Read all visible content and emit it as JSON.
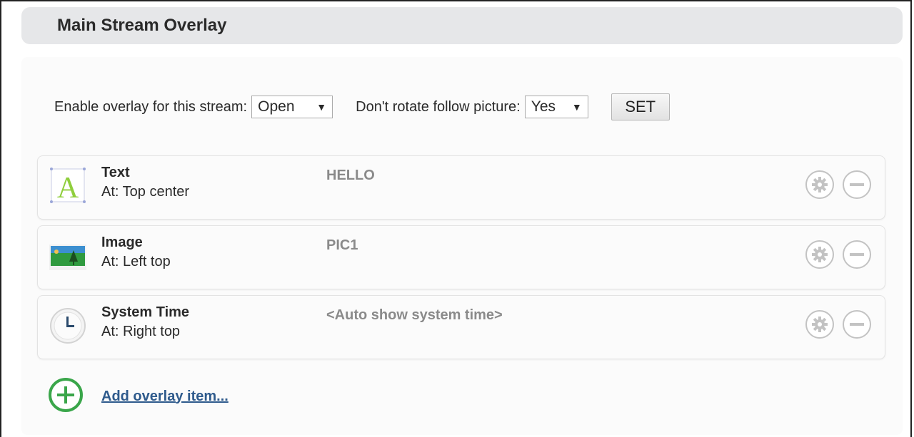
{
  "header": {
    "title": "Main Stream Overlay"
  },
  "settings": {
    "enable_label": "Enable overlay for this stream:",
    "enable_value": "Open",
    "rotate_label": "Don't rotate follow picture:",
    "rotate_value": "Yes",
    "set_label": "SET"
  },
  "items": [
    {
      "name": "Text",
      "position": "At: Top center",
      "content": "HELLO",
      "icon": "text-icon"
    },
    {
      "name": "Image",
      "position": "At: Left top",
      "content": "PIC1",
      "icon": "image-icon"
    },
    {
      "name": "System Time",
      "position": "At: Right top",
      "content": "<Auto show system time>",
      "icon": "clock-icon"
    }
  ],
  "add_item": {
    "label": "Add overlay item..."
  },
  "colors": {
    "header_bg": "#e6e7e9",
    "link": "#2e5a8c",
    "add_icon": "#3aa64a",
    "control_icon": "#bbbbbb"
  }
}
